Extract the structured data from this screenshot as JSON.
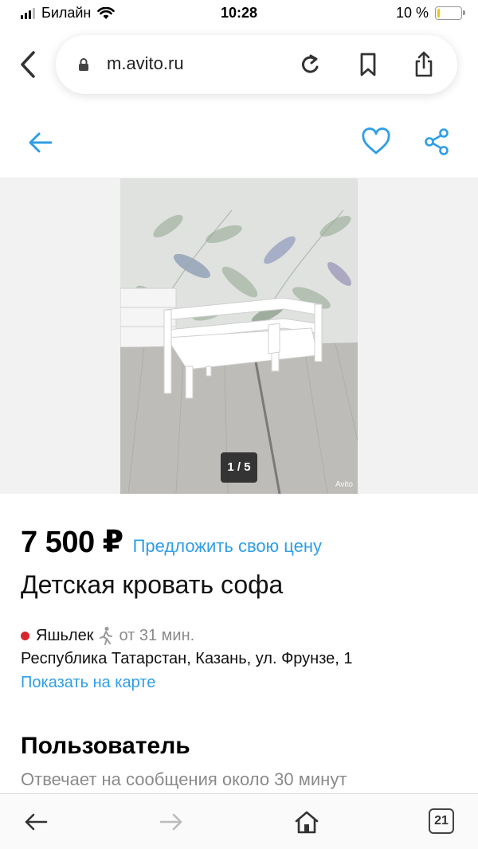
{
  "status_bar": {
    "carrier": "Билайн",
    "time": "10:28",
    "battery_percent": "10 %",
    "battery_level": 0.1,
    "icons": [
      "signal-icon",
      "wifi-icon",
      "battery-icon"
    ]
  },
  "browser": {
    "url": "m.avito.ru",
    "icons": [
      "back-chevron-icon",
      "lock-icon",
      "reload-icon",
      "bookmark-icon",
      "share-icon"
    ]
  },
  "app_header": {
    "icons": [
      "back-arrow-icon",
      "favorite-heart-icon",
      "share-nodes-icon"
    ],
    "accent_color": "#2f9ee6"
  },
  "gallery": {
    "counter": "1 / 5",
    "watermark": "Avito"
  },
  "listing": {
    "price": "7 500 ₽",
    "offer_link": "Предложить свою цену",
    "title": "Детская кровать софа",
    "metro_station": "Яшьлек",
    "metro_color": "#d7262d",
    "walk_time": "от 31 мин.",
    "address": "Республика Татарстан, Казань, ул. Фрунзе, 1",
    "map_link": "Показать на карте"
  },
  "seller": {
    "section_title": "Пользователь",
    "reply_note": "Отвечает на сообщения около 30 минут"
  },
  "toolbar": {
    "tabs_count": "21",
    "icons": [
      "back-arrow-icon",
      "forward-arrow-icon",
      "home-icon",
      "tabs-icon"
    ]
  }
}
